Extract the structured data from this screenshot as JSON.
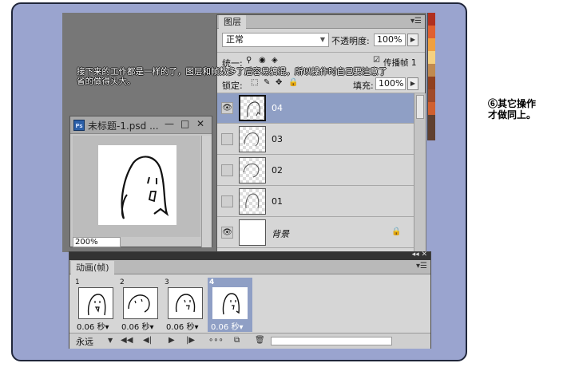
{
  "tutorial": {
    "line1": "接下来的工作都是一样的了，图层和帧数多了后容易搞混，所以操作时自己要注意了",
    "line2": "省的做得头大。"
  },
  "side_note": {
    "line1": "⑥其它操作",
    "line2": "才做同上。"
  },
  "layers_panel": {
    "tab": "图层",
    "menu_glyph": "▾☰",
    "blend_mode": "正常",
    "opacity_label": "不透明度:",
    "opacity_value": "100%",
    "unify_label": "统一:",
    "propagate_label": "传播帧 1",
    "lock_label": "锁定:",
    "fill_label": "填充:",
    "fill_value": "100%",
    "layers": [
      {
        "name": "04",
        "visible": true,
        "selected": true
      },
      {
        "name": "03",
        "visible": false,
        "selected": false
      },
      {
        "name": "02",
        "visible": false,
        "selected": false
      },
      {
        "name": "01",
        "visible": false,
        "selected": false
      },
      {
        "name": "背景",
        "visible": true,
        "selected": false,
        "locked": true
      }
    ]
  },
  "document": {
    "title": "未标题-1.psd ...",
    "ps_icon": "Ps",
    "min": "—",
    "max": "□",
    "close": "✕",
    "zoom": "200%"
  },
  "animation_panel": {
    "tab": "动画(帧)",
    "collapse_glyph": "◂◂ ✕",
    "menu_glyph": "▾☰",
    "frames": [
      {
        "number": "1",
        "delay": "0.06 秒▾",
        "selected": false
      },
      {
        "number": "2",
        "delay": "0.06 秒▾",
        "selected": false
      },
      {
        "number": "3",
        "delay": "0.06 秒▾",
        "selected": false
      },
      {
        "number": "4",
        "delay": "0.06 秒▾",
        "selected": true
      }
    ],
    "loop": "永远",
    "controls": {
      "first": "◀◀",
      "prev": "◀|",
      "play": "▶",
      "next": "|▶",
      "tween": "∘∘∘",
      "duplicate": "⧉",
      "delete": "🗑"
    }
  }
}
